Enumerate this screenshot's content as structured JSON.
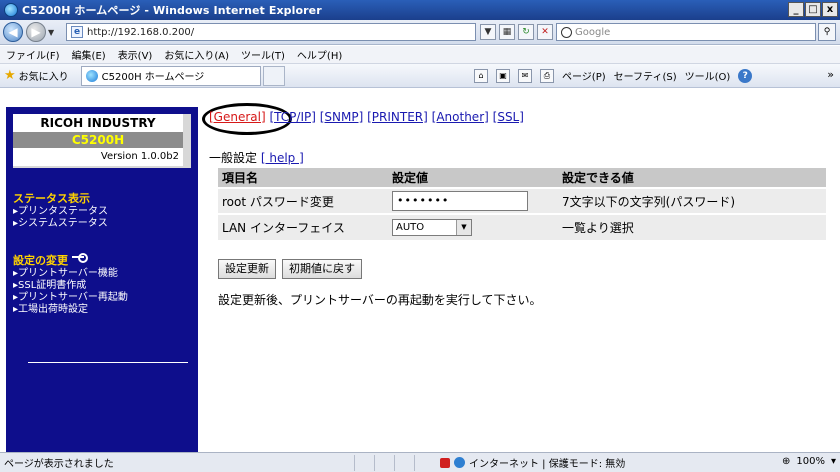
{
  "window": {
    "title": "C5200H ホームページ - Windows Internet Explorer",
    "minimize": "_",
    "maximize": "□",
    "close": "x"
  },
  "address": {
    "url": "http://192.168.0.200/",
    "search_placeholder": "Google"
  },
  "menu": [
    "ファイル(F)",
    "編集(E)",
    "表示(V)",
    "お気に入り(A)",
    "ツール(T)",
    "ヘルプ(H)"
  ],
  "favorites": {
    "label": "お気に入り",
    "tab_title": "C5200H ホームページ",
    "tools": [
      "ページ(P)",
      "セーフティ(S)",
      "ツール(O)"
    ]
  },
  "sidebar": {
    "brand": "RICOH INDUSTRY",
    "model": "C5200H",
    "version": "Version 1.0.0b2",
    "status_heading": "ステータス表示",
    "status_links": [
      "▸プリンタステータス",
      "▸システムステータス"
    ],
    "settings_heading": "設定の変更",
    "settings_links": [
      "▸プリントサーバー機能",
      "▸SSL証明書作成",
      "▸プリントサーバー再起動",
      "▸工場出荷時設定"
    ]
  },
  "main": {
    "tabs": [
      "[General]",
      "[TCP/IP]",
      "[SNMP]",
      "[PRINTER]",
      "[Another]",
      "[SSL]"
    ],
    "section_title": "一般設定",
    "help_link": "[ help ]",
    "table": {
      "headers": [
        "項目名",
        "設定値",
        "設定できる値"
      ],
      "rows": [
        {
          "name": "root パスワード変更",
          "value": "•••••••",
          "allowed": "7文字以下の文字列(パスワード)"
        },
        {
          "name": "LAN インターフェイス",
          "value": "AUTO",
          "allowed": "一覧より選択"
        }
      ]
    },
    "buttons": {
      "update": "設定更新",
      "reset": "初期値に戻す"
    },
    "notice": "設定更新後、プリントサーバーの再起動を実行して下さい。"
  },
  "status": {
    "text": "ページが表示されました",
    "zone": "インターネット | 保護モード: 無効",
    "zoom": "100%"
  }
}
